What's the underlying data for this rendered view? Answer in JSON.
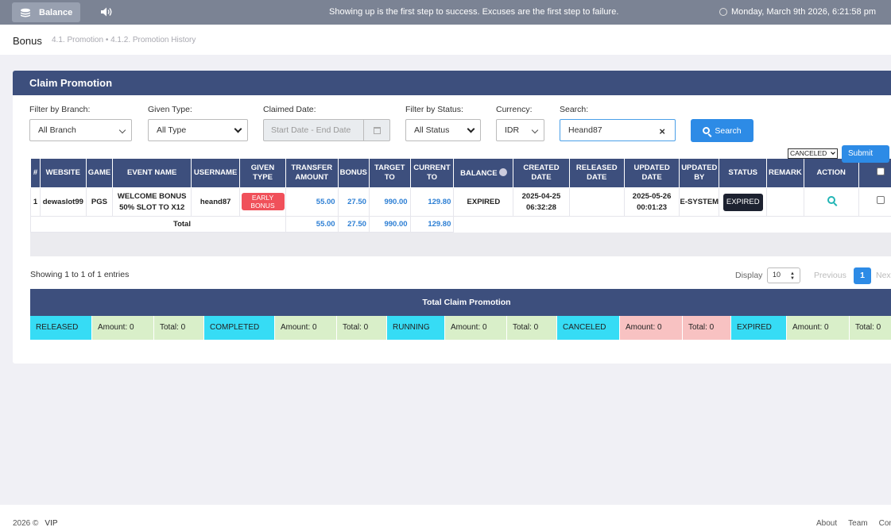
{
  "topbar": {
    "balance_label": "Balance",
    "motto": "Showing up is the first step to success. Excuses are the first step to failure.",
    "datetime": "Monday, March 9th 2026, 6:21:58 pm"
  },
  "breadcrumb": {
    "title": "Bonus",
    "path": "4.1. Promotion  •  4.1.2. Promotion History"
  },
  "card": {
    "title": "Claim Promotion"
  },
  "filters": {
    "branch_label": "Filter by Branch:",
    "branch_value": "All Branch",
    "type_label": "Given Type:",
    "type_value": "All Type",
    "date_label": "Claimed Date:",
    "date_placeholder": "Start Date - End Date",
    "status_label": "Filter by Status:",
    "status_value": "All Status",
    "currency_label": "Currency:",
    "currency_value": "IDR",
    "search_label": "Search:",
    "search_value": "Heand87",
    "search_button": "Search"
  },
  "table": {
    "headers": [
      "#",
      "WEBSITE",
      "GAME",
      "EVENT NAME",
      "USERNAME",
      "GIVEN TYPE",
      "TRANSFER AMOUNT",
      "BONUS",
      "TARGET TO",
      "CURRENT TO",
      "BALANCE",
      "CREATED DATE",
      "RELEASED DATE",
      "UPDATED DATE",
      "UPDATED BY",
      "STATUS",
      "REMARK",
      "ACTION"
    ],
    "rows": [
      {
        "no": "1",
        "website": "dewaslot99",
        "game": "PGS",
        "event_name": "WELCOME BONUS 50% SLOT TO X12",
        "username": "heand87",
        "given_type": "EARLY BONUS",
        "transfer_amount": "55.00",
        "bonus": "27.50",
        "target_to": "990.00",
        "current_to": "129.80",
        "balance": "EXPIRED",
        "created_date": "2025-04-25 06:32:28",
        "released_date": "",
        "updated_date": "2025-05-26 00:01:23",
        "updated_by": "E-SYSTEM",
        "status": "EXPIRED",
        "remark": ""
      }
    ],
    "total": {
      "label": "Total",
      "transfer_amount": "55.00",
      "bonus": "27.50",
      "target_to": "990.00",
      "current_to": "129.80"
    }
  },
  "bulk": {
    "status_value": "CANCELED",
    "submit_label": "Submit"
  },
  "pagination": {
    "showing": "Showing 1 to 1 of 1 entries",
    "display_label": "Display",
    "display_value": "10",
    "previous": "Previous",
    "current_page": "1",
    "next": "Next"
  },
  "summary": {
    "title": "Total Claim Promotion",
    "cells": [
      {
        "text": "RELEASED",
        "color": "#36dcf5"
      },
      {
        "text": "Amount: 0",
        "color": "#d9efc9"
      },
      {
        "text": "Total: 0",
        "color": "#d9efc9"
      },
      {
        "text": "COMPLETED",
        "color": "#36dcf5"
      },
      {
        "text": "Amount: 0",
        "color": "#d9efc9"
      },
      {
        "text": "Total: 0",
        "color": "#d9efc9"
      },
      {
        "text": "RUNNING",
        "color": "#36dcf5"
      },
      {
        "text": "Amount: 0",
        "color": "#d9efc9"
      },
      {
        "text": "Total: 0",
        "color": "#d9efc9"
      },
      {
        "text": "CANCELED",
        "color": "#36dcf5"
      },
      {
        "text": "Amount: 0",
        "color": "#f8c2c2"
      },
      {
        "text": "Total: 0",
        "color": "#f8c2c2"
      },
      {
        "text": "EXPIRED",
        "color": "#36dcf5"
      },
      {
        "text": "Amount: 0",
        "color": "#d9efc9"
      },
      {
        "text": "Total: 0",
        "color": "#d9efc9"
      }
    ]
  },
  "footer": {
    "copyright": "2026 ©",
    "brand": "VIP",
    "links": [
      "About",
      "Team",
      "Contact"
    ]
  }
}
